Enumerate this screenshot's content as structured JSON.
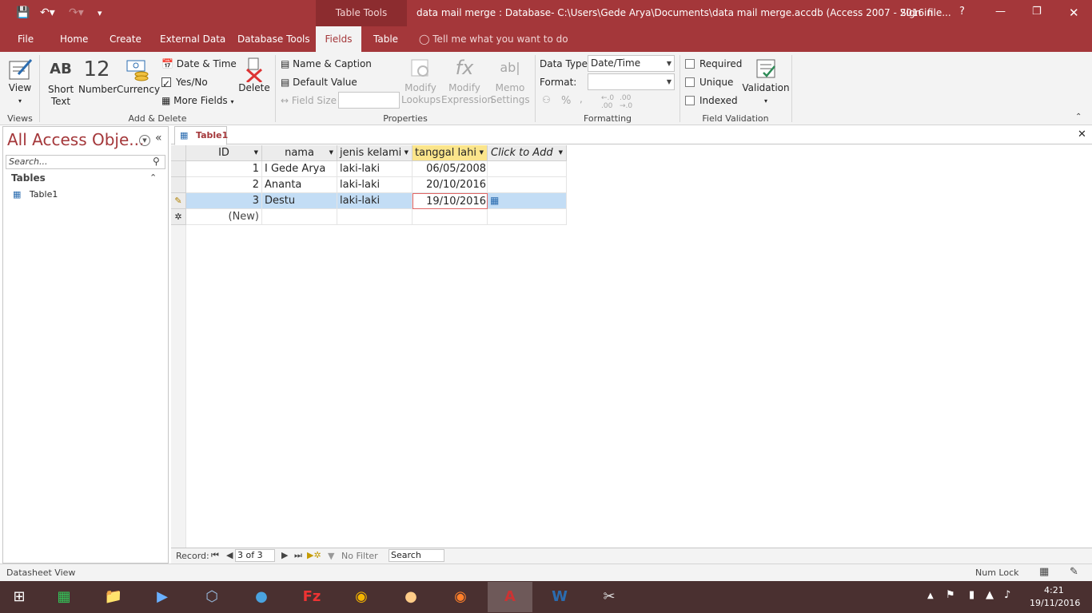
{
  "title_bar": {
    "context_tools": "Table Tools",
    "document_title": "data mail merge : Database- C:\\Users\\Gede Arya\\Documents\\data mail merge.accdb (Access 2007 - 2016 file...",
    "sign_in": "Sign in",
    "help": "?"
  },
  "tabs": [
    "File",
    "Home",
    "Create",
    "External Data",
    "Database Tools",
    "Fields",
    "Table"
  ],
  "active_tab": "Fields",
  "tell_me": "Tell me what you want to do",
  "ribbon": {
    "views": {
      "view": "View",
      "group": "Views"
    },
    "add_delete": {
      "short_text": "Short Text",
      "short_text_icon": "AB",
      "number": "Number",
      "number_icon": "12",
      "currency": "Currency",
      "date_time": "Date & Time",
      "yes_no": "Yes/No",
      "more_fields": "More Fields",
      "delete": "Delete",
      "group": "Add & Delete"
    },
    "properties": {
      "name_caption": "Name & Caption",
      "default_value": "Default Value",
      "field_size": "Field Size",
      "modify_lookups": "Modify Lookups",
      "modify_expression": "Modify Expression",
      "memo_settings": "Memo Settings",
      "group": "Properties"
    },
    "formatting": {
      "data_type_label": "Data Type:",
      "data_type_value": "Date/Time",
      "format_label": "Format:",
      "format_value": "",
      "percent": "%",
      "comma": ",",
      "group": "Formatting"
    },
    "validation": {
      "required": "Required",
      "unique": "Unique",
      "indexed": "Indexed",
      "validation": "Validation",
      "group": "Field Validation"
    }
  },
  "nav_pane": {
    "title": "All Access Obje...",
    "search_placeholder": "Search...",
    "section": "Tables",
    "items": [
      "Table1"
    ]
  },
  "document_tab": "Table1",
  "table": {
    "columns": [
      "ID",
      "nama",
      "jenis kelami",
      "tanggal lahi",
      "Click to Add"
    ],
    "rows": [
      {
        "id": "1",
        "nama": "I Gede Arya",
        "jenis_kelamin": "laki-laki",
        "tanggal_lahir": "06/05/2008"
      },
      {
        "id": "2",
        "nama": "Ananta",
        "jenis_kelamin": "laki-laki",
        "tanggal_lahir": "20/10/2016"
      },
      {
        "id": "3",
        "nama": "Destu",
        "jenis_kelamin": "laki-laki",
        "tanggal_lahir": "19/10/2016"
      }
    ],
    "new_row": "(New)"
  },
  "record_nav": {
    "label": "Record:",
    "position": "3 of 3",
    "no_filter": "No Filter",
    "search": "Search"
  },
  "status_bar": {
    "view": "Datasheet View",
    "num_lock": "Num Lock"
  },
  "taskbar": {
    "time": "4:21",
    "date": "19/11/2016"
  }
}
